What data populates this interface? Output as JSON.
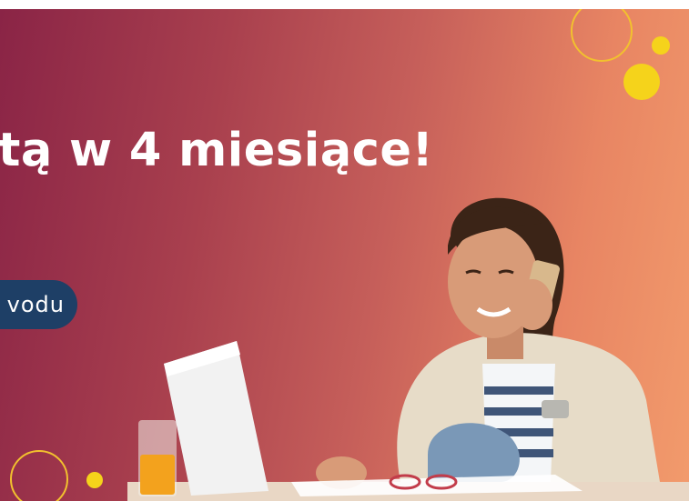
{
  "banner": {
    "headline": "tą w 4 miesiące!",
    "cta_label": "vodu",
    "colors": {
      "gradient_start": "#8a2446",
      "gradient_end": "#f29b6c",
      "headline_text": "#ffffff",
      "cta_background": "#1e3f66",
      "accent_yellow": "#f5d31b"
    }
  }
}
